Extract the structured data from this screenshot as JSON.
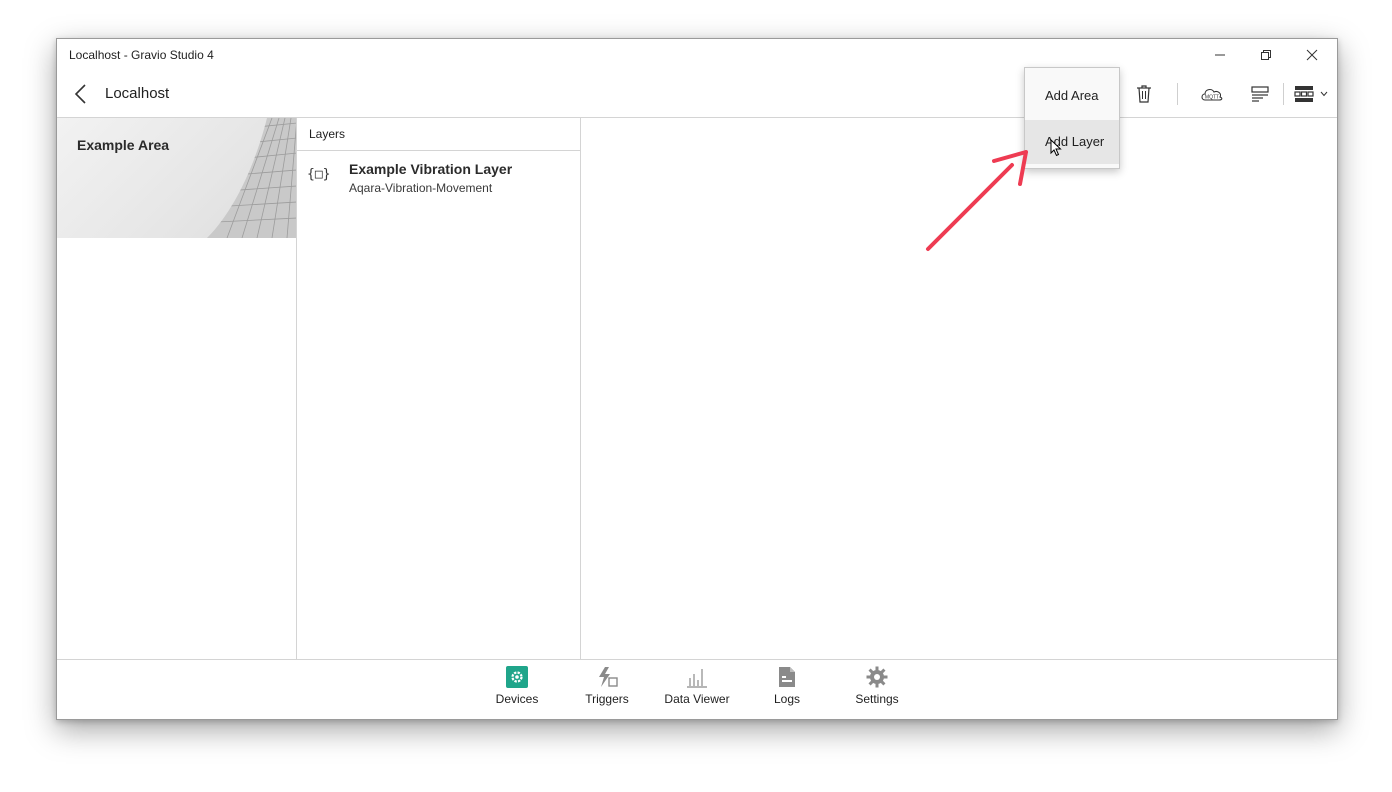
{
  "window": {
    "title": "Localhost - Gravio Studio 4"
  },
  "header": {
    "title": "Localhost"
  },
  "toolbar": {
    "icons": [
      "delete-icon",
      "mqtt-icon",
      "layer-settings-icon",
      "view-layout-icon",
      "chevron-down-icon"
    ],
    "mqtt_label": "MQTT"
  },
  "dropdown": {
    "items": [
      {
        "label": "Add Area"
      },
      {
        "label": "Add Layer",
        "hovered": true
      }
    ]
  },
  "areas": {
    "items": [
      {
        "name": "Example Area"
      }
    ]
  },
  "layers": {
    "header": "Layers",
    "items": [
      {
        "icon": "{□}",
        "name": "Example Vibration Layer",
        "type": "Aqara-Vibration-Movement"
      }
    ]
  },
  "bottom_nav": {
    "items": [
      {
        "label": "Devices",
        "icon": "devices-icon",
        "active": true
      },
      {
        "label": "Triggers",
        "icon": "triggers-icon"
      },
      {
        "label": "Data Viewer",
        "icon": "data-viewer-icon"
      },
      {
        "label": "Logs",
        "icon": "logs-icon"
      },
      {
        "label": "Settings",
        "icon": "settings-icon"
      }
    ]
  },
  "colors": {
    "accent": "#1fa58a",
    "annotation_arrow": "#ee3b52",
    "icon_gray": "#8a8a8a"
  }
}
